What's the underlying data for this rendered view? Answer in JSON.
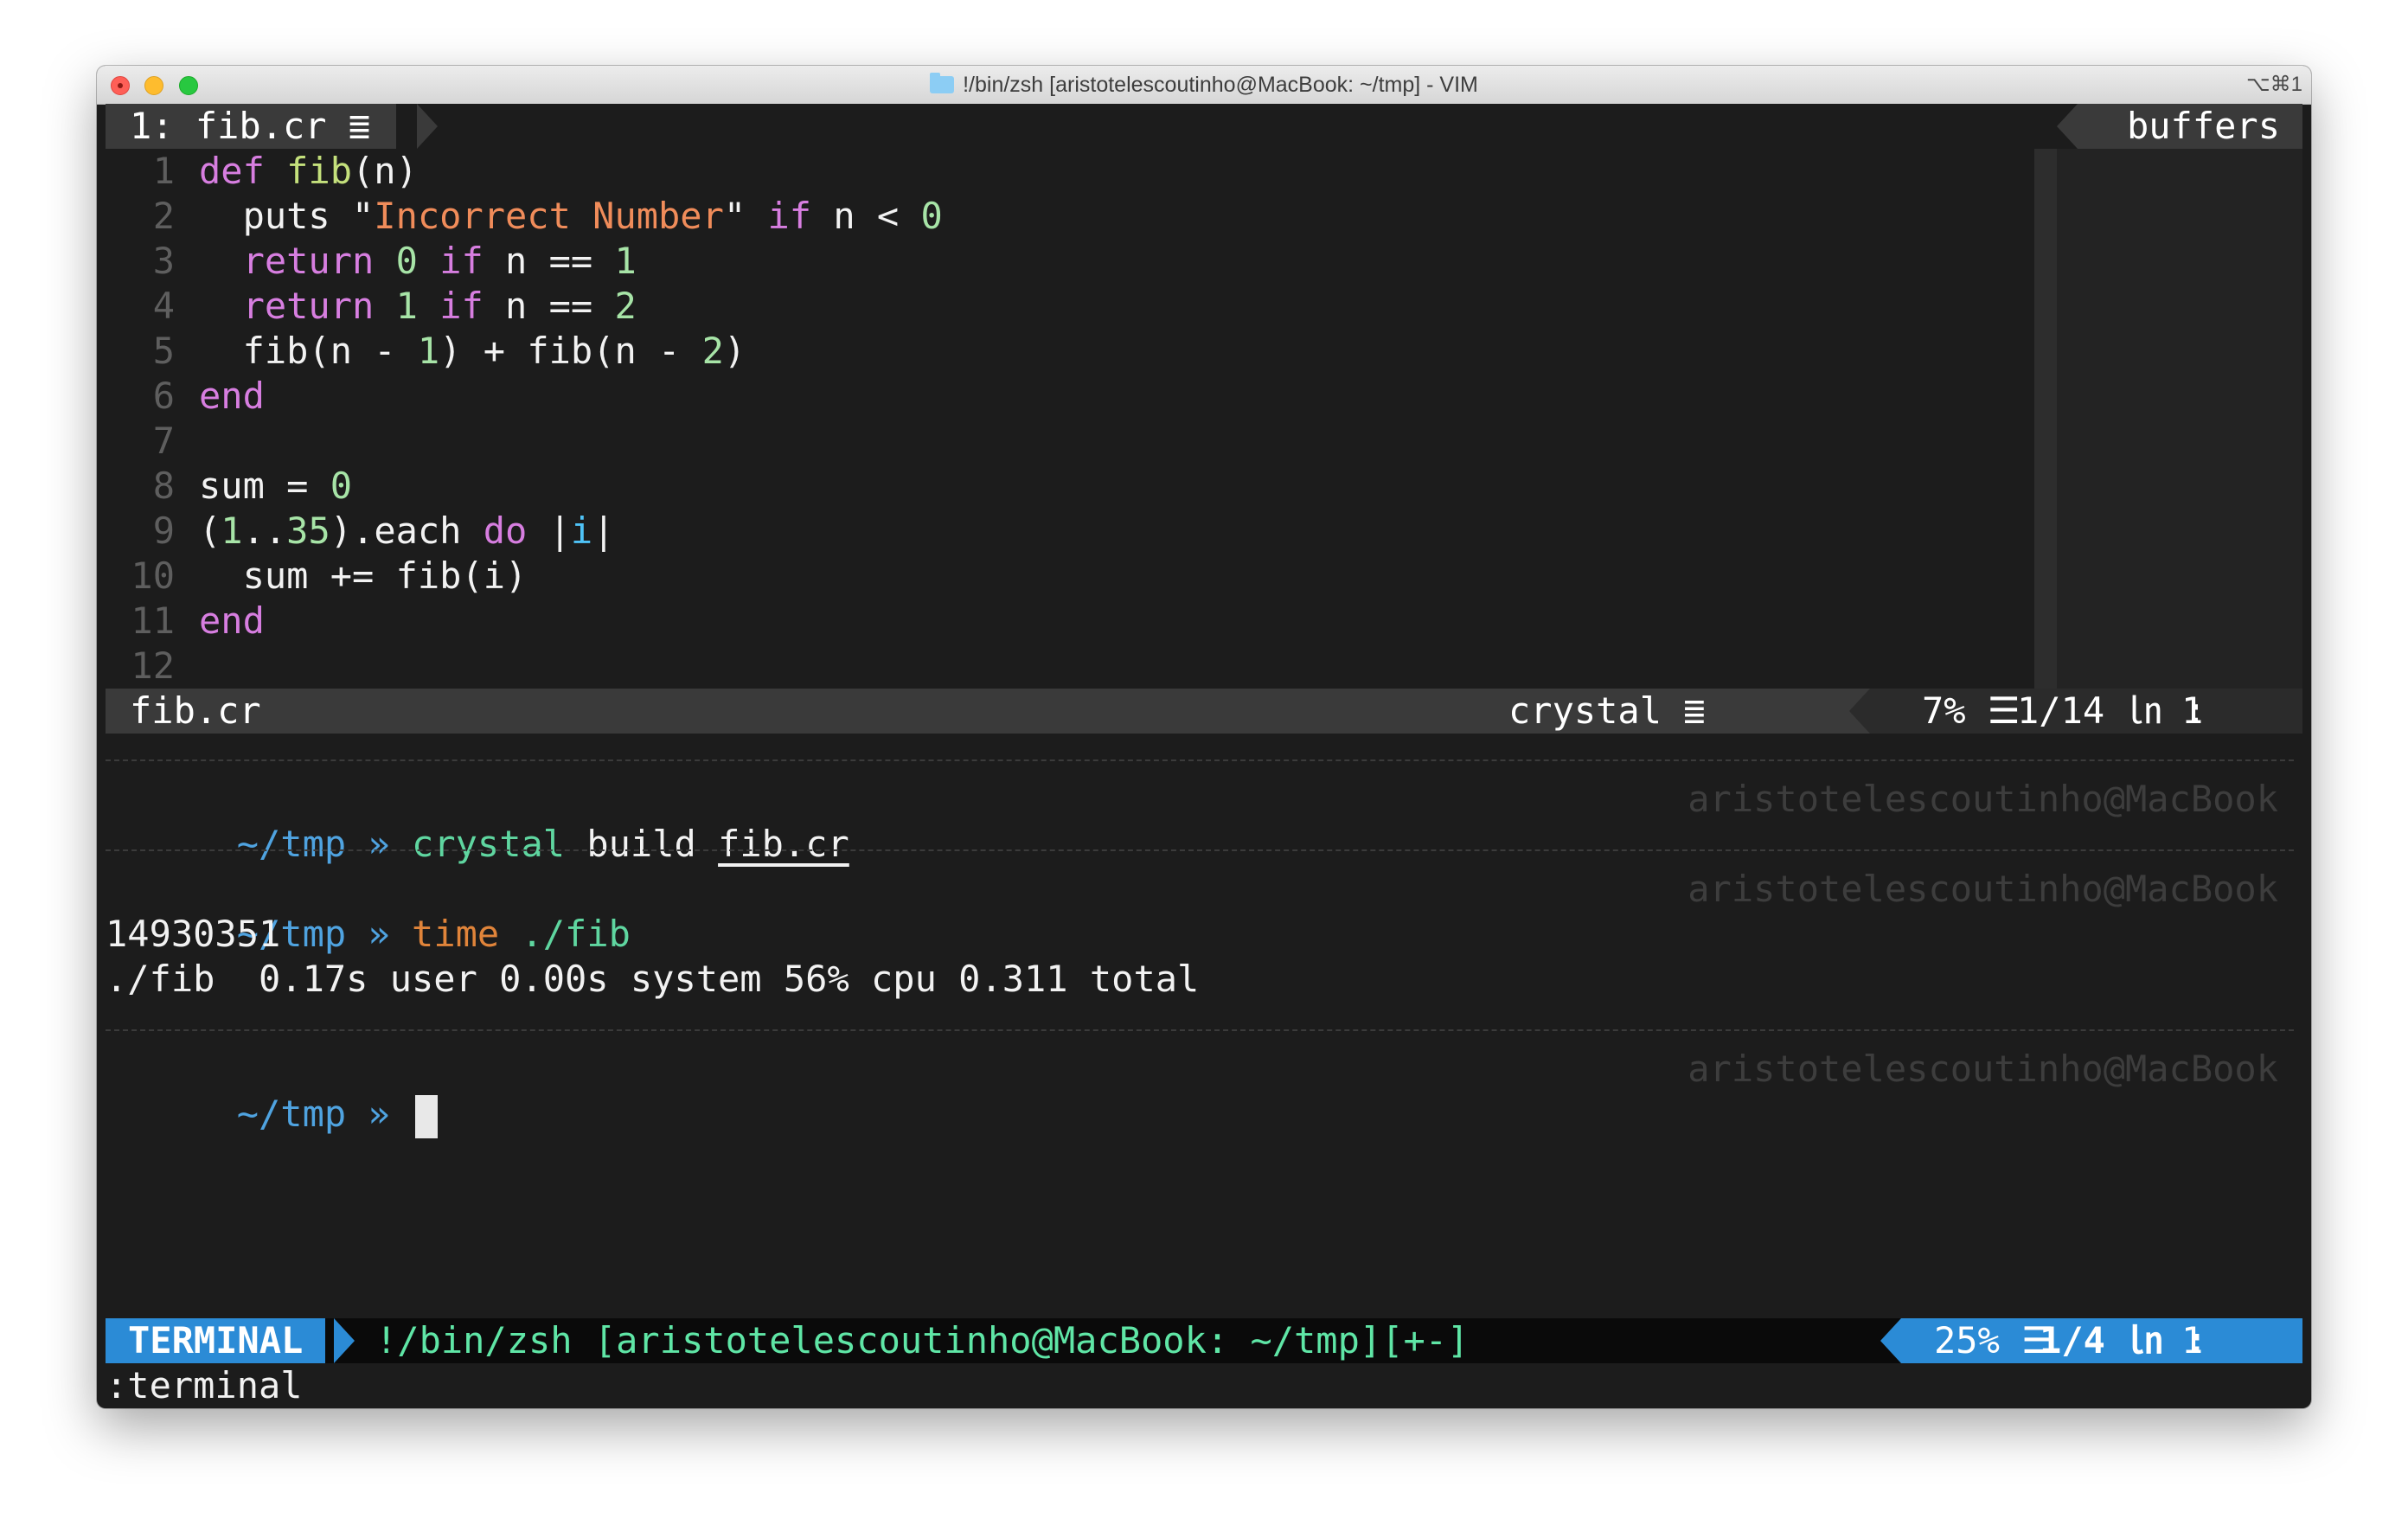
{
  "window": {
    "title": "!/bin/zsh [aristotelescoutinho@MacBook: ~/tmp] - VIM",
    "shortcut": "⌥⌘1"
  },
  "tabline": {
    "tab": "1: fib.cr ≣",
    "buffers": "buffers"
  },
  "code": [
    {
      "n": "1",
      "parts": [
        {
          "c": "kw",
          "t": "def "
        },
        {
          "c": "fn",
          "t": "fib"
        },
        {
          "c": "tx",
          "t": "(n)"
        }
      ]
    },
    {
      "n": "2",
      "parts": [
        {
          "c": "tx",
          "t": "  puts \""
        },
        {
          "c": "str",
          "t": "Incorrect Number"
        },
        {
          "c": "tx",
          "t": "\" "
        },
        {
          "c": "kw",
          "t": "if"
        },
        {
          "c": "tx",
          "t": " n < "
        },
        {
          "c": "num",
          "t": "0"
        }
      ]
    },
    {
      "n": "3",
      "parts": [
        {
          "c": "tx",
          "t": "  "
        },
        {
          "c": "kw",
          "t": "return"
        },
        {
          "c": "tx",
          "t": " "
        },
        {
          "c": "num",
          "t": "0"
        },
        {
          "c": "tx",
          "t": " "
        },
        {
          "c": "kw",
          "t": "if"
        },
        {
          "c": "tx",
          "t": " n == "
        },
        {
          "c": "num",
          "t": "1"
        }
      ]
    },
    {
      "n": "4",
      "parts": [
        {
          "c": "tx",
          "t": "  "
        },
        {
          "c": "kw",
          "t": "return"
        },
        {
          "c": "tx",
          "t": " "
        },
        {
          "c": "num",
          "t": "1"
        },
        {
          "c": "tx",
          "t": " "
        },
        {
          "c": "kw",
          "t": "if"
        },
        {
          "c": "tx",
          "t": " n == "
        },
        {
          "c": "num",
          "t": "2"
        }
      ]
    },
    {
      "n": "5",
      "parts": [
        {
          "c": "tx",
          "t": "  fib(n - "
        },
        {
          "c": "num",
          "t": "1"
        },
        {
          "c": "tx",
          "t": ") + fib(n - "
        },
        {
          "c": "num",
          "t": "2"
        },
        {
          "c": "tx",
          "t": ")"
        }
      ]
    },
    {
      "n": "6",
      "parts": [
        {
          "c": "kw",
          "t": "end"
        }
      ]
    },
    {
      "n": "7",
      "parts": []
    },
    {
      "n": "8",
      "parts": [
        {
          "c": "tx",
          "t": "sum = "
        },
        {
          "c": "num",
          "t": "0"
        }
      ]
    },
    {
      "n": "9",
      "parts": [
        {
          "c": "tx",
          "t": "("
        },
        {
          "c": "num",
          "t": "1"
        },
        {
          "c": "tx",
          "t": ".."
        },
        {
          "c": "num",
          "t": "35"
        },
        {
          "c": "tx",
          "t": ").each "
        },
        {
          "c": "kw",
          "t": "do"
        },
        {
          "c": "tx",
          "t": " |"
        },
        {
          "c": "blk",
          "t": "i"
        },
        {
          "c": "tx",
          "t": "|"
        }
      ]
    },
    {
      "n": "10",
      "parts": [
        {
          "c": "tx",
          "t": "  sum += fib(i)"
        }
      ]
    },
    {
      "n": "11",
      "parts": [
        {
          "c": "kw",
          "t": "end"
        }
      ]
    },
    {
      "n": "12",
      "parts": []
    }
  ],
  "statusline": {
    "file": "fib.cr",
    "filetype": "crystal ≣",
    "percent": "7% ☰",
    "position": "1/14 ㏑ :",
    "column": "1"
  },
  "shell": {
    "path": "~/tmp",
    "arrow": "»",
    "host": "aristotelescoutinho@MacBook",
    "cmd1": {
      "prog": "crystal",
      "args": " build ",
      "file": "fib.cr"
    },
    "cmd2": {
      "prog": "time",
      "args": " ./fib"
    },
    "output1": "14930351",
    "output2": "./fib  0.17s user 0.00s system 56% cpu 0.311 total"
  },
  "term_status": {
    "mode": "TERMINAL",
    "title": "!/bin/zsh [aristotelescoutinho@MacBook: ~/tmp][+-]",
    "percent": "25% ☰",
    "position": "1/4 ㏑ :",
    "column": "1"
  },
  "cmdline": ":terminal"
}
